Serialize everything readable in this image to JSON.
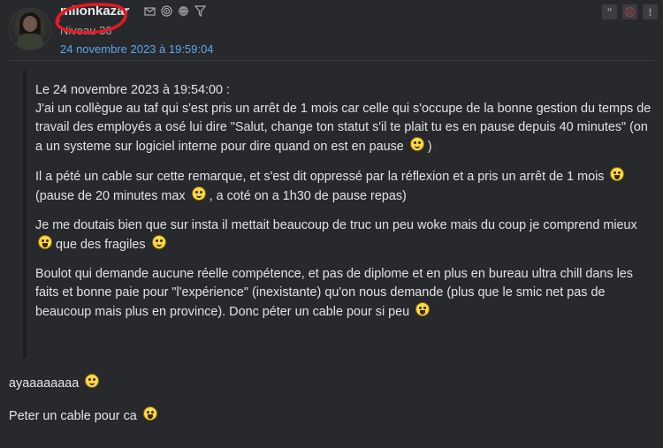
{
  "author": {
    "name": "mlionkazar",
    "level": "Niveau 36",
    "date": "24 novembre 2023 à 19:59:04",
    "icons": [
      "mail-icon",
      "spiral-icon",
      "globe-icon",
      "filter-icon"
    ]
  },
  "actions": {
    "icons": [
      "quote-icon",
      "sad-face-icon",
      "alert-icon"
    ],
    "quote_label": "”",
    "sad_label": "☹",
    "alert_label": "!"
  },
  "quote": {
    "header": "Le 24 novembre 2023 à 19:54:00 :",
    "p1": "J'ai un collègue au taf qui s'est pris un arrêt de 1 mois car celle qui s'occupe de la bonne gestion du temps de travail des employés a osé lui dire \"Salut, change ton statut s'il te plait tu es en pause depuis 40 minutes\" (on a un systeme sur logiciel interne pour dire quand on est en pause",
    "p1_end": ")",
    "p2a": "Il a pété un cable sur cette remarque, et s'est dit oppressé par la réflexion et a pris un arrêt de 1 mois",
    "p2b": "(pause de 20 minutes max",
    "p2c": ", a coté on a 1h30 de pause repas)",
    "p3a": "Je me doutais bien que sur insta il mettait beaucoup de truc un peu woke mais du coup je comprend mieux",
    "p3b": "que des fragiles",
    "p4": "Boulot qui demande aucune réelle compétence, et pas de diplome et en plus en bureau ultra chill dans les faits et bonne paie pour \"l'expérience\" (inexistante) qu'on nous demande (plus que le smic net pas de beaucoup mais plus en province). Donc péter un cable pour si peu"
  },
  "reply": {
    "line1": "ayaaaaaaaa",
    "line2": "Peter un cable pour ca"
  },
  "colors": {
    "background": "#27292d",
    "link": "#5ea7e8",
    "annotation": "#e01b24"
  }
}
